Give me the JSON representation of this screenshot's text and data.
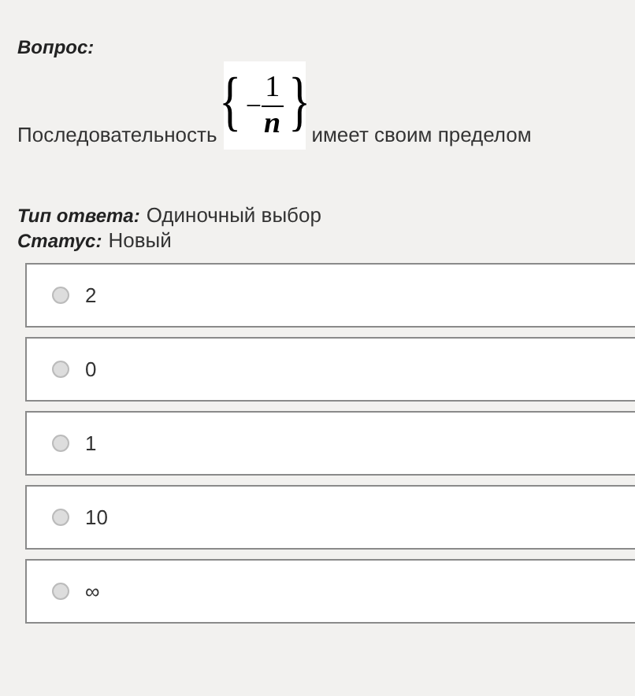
{
  "question": {
    "label": "Вопрос:",
    "text_before": "Последовательность",
    "formula": {
      "open": "{",
      "sign": "−",
      "numerator": "1",
      "denominator": "n",
      "close": "}"
    },
    "text_after": "имеет своим пределом"
  },
  "answer_type": {
    "label": "Тип ответа:",
    "value": "Одиночный выбор"
  },
  "status": {
    "label": "Статус:",
    "value": "Новый"
  },
  "options": [
    {
      "label": "2",
      "selected": false
    },
    {
      "label": "0",
      "selected": false
    },
    {
      "label": "1",
      "selected": false
    },
    {
      "label": "10",
      "selected": false
    },
    {
      "label": "∞",
      "selected": false
    }
  ]
}
